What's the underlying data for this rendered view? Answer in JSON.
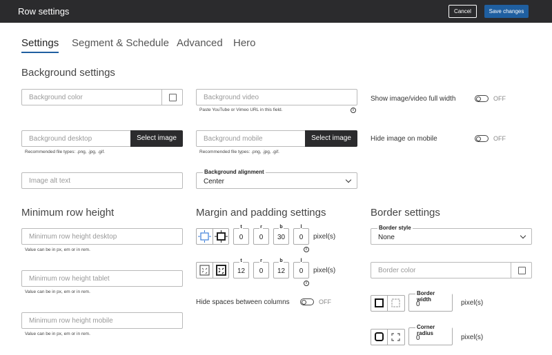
{
  "header": {
    "title": "Row settings",
    "cancel_label": "Cancel",
    "save_label": "Save changes"
  },
  "tabs": [
    {
      "label": "Settings",
      "active": true
    },
    {
      "label": "Segment & Schedule",
      "active": false
    },
    {
      "label": "Advanced",
      "active": false
    },
    {
      "label": "Hero",
      "active": false
    }
  ],
  "background": {
    "heading": "Background settings",
    "color_placeholder": "Background color",
    "video_placeholder": "Background video",
    "video_help": "Paste YouTube or Vimeo URL in this field.",
    "full_width_label": "Show image/video full width",
    "full_width_state": "OFF",
    "desktop_placeholder": "Background desktop",
    "select_image_label": "Select image",
    "desktop_help": "Recommended file types: .png, .jpg, .gif.",
    "mobile_placeholder": "Background mobile",
    "mobile_select_image_label": "Select image",
    "mobile_help": "Recommended file types: .png, .jpg, .gif.",
    "hide_mobile_label": "Hide image on mobile",
    "hide_mobile_state": "OFF",
    "alt_placeholder": "Image alt text",
    "alignment_label": "Background alignment",
    "alignment_value": "Center"
  },
  "min_height": {
    "heading": "Minimum row height",
    "desktop_placeholder": "Minimum row height desktop",
    "desktop_help": "Value can be in px, em or in rem.",
    "tablet_placeholder": "Minimum row height tablet",
    "tablet_help": "Value can be in px, em or in rem.",
    "mobile_placeholder": "Minimum row height mobile",
    "mobile_help": "Value can be in px, em or in rem."
  },
  "spacing": {
    "heading": "Margin and padding settings",
    "margin": {
      "t": "0",
      "r": "0",
      "b": "30",
      "l": "0",
      "unit": "pixel(s)"
    },
    "padding": {
      "t": "12",
      "r": "0",
      "b": "12",
      "l": "0",
      "unit": "pixel(s)"
    },
    "labels": {
      "t": "t",
      "r": "r",
      "b": "b",
      "l": "l"
    },
    "hide_spaces_label": "Hide spaces between columns",
    "hide_spaces_state": "OFF"
  },
  "border": {
    "heading": "Border settings",
    "style_label": "Border style",
    "style_value": "None",
    "color_placeholder": "Border color",
    "width_label": "Border width",
    "width_value": "0",
    "width_unit": "pixel(s)",
    "radius_label": "Corner radius",
    "radius_value": "0",
    "radius_unit": "pixel(s)"
  }
}
